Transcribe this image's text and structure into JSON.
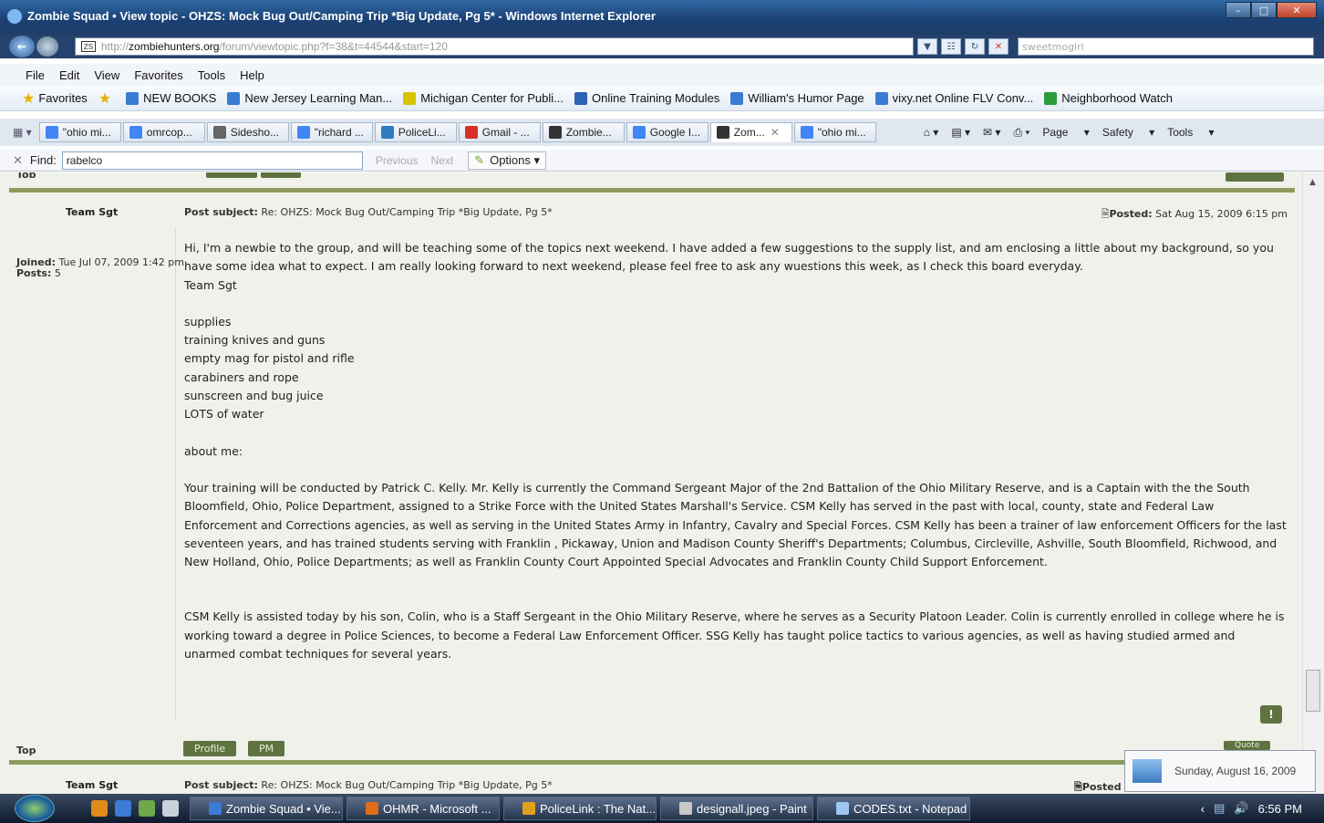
{
  "window": {
    "title": "Zombie Squad • View topic - OHZS: Mock Bug Out/Camping Trip *Big Update, Pg 5* - Windows Internet Explorer"
  },
  "address": {
    "url_prefix": "http://",
    "url_domain": "zombiehunters.org",
    "url_rest": "/forum/viewtopic.php?f=38&t=44544&start=120",
    "search_value": "sweetmogirl"
  },
  "menu": [
    "File",
    "Edit",
    "View",
    "Favorites",
    "Tools",
    "Help"
  ],
  "favorites": {
    "label": "Favorites",
    "items": [
      {
        "label": "NEW BOOKS",
        "color": "#3a7bd5"
      },
      {
        "label": "New Jersey Learning Man...",
        "color": "#3a7bd5"
      },
      {
        "label": "Michigan Center for Publi...",
        "color": "#d9c300"
      },
      {
        "label": "Online Training Modules",
        "color": "#2b63b5"
      },
      {
        "label": "William's Humor Page",
        "color": "#3a7bd5"
      },
      {
        "label": "vixy.net Online FLV Conv...",
        "color": "#3a7bd5"
      },
      {
        "label": "Neighborhood Watch",
        "color": "#2a9b3a"
      }
    ]
  },
  "tabs": [
    {
      "label": "\"ohio mi...",
      "color": "#4285f4"
    },
    {
      "label": "omrcop...",
      "color": "#4285f4"
    },
    {
      "label": "Sidesho...",
      "color": "#666666"
    },
    {
      "label": "\"richard ...",
      "color": "#4285f4"
    },
    {
      "label": "PoliceLi...",
      "color": "#2f7bbf"
    },
    {
      "label": "Gmail - ...",
      "color": "#d93025"
    },
    {
      "label": "Zombie...",
      "color": "#333333"
    },
    {
      "label": "Google I...",
      "color": "#4285f4"
    },
    {
      "label": "Zom...",
      "color": "#333333"
    },
    {
      "label": "\"ohio mi...",
      "color": "#4285f4"
    }
  ],
  "toolbar": {
    "page": "Page",
    "safety": "Safety",
    "tools": "Tools"
  },
  "find": {
    "label": "Find:",
    "value": "rabelco",
    "previous": "Previous",
    "next": "Next",
    "options": "Options"
  },
  "post": {
    "author": "Team Sgt",
    "subject_label": "Post subject:",
    "subject": "Re: OHZS: Mock Bug Out/Camping Trip *Big Update, Pg 5*",
    "posted_label": "Posted:",
    "posted": "Sat Aug 15, 2009 6:15 pm",
    "joined_label": "Joined:",
    "joined": "Tue Jul 07, 2009 1:42 pm",
    "posts_label": "Posts:",
    "posts": "5",
    "intro": "Hi, I'm a newbie to the group, and will be teaching some of the topics next weekend. I have added a few suggestions to the supply list, and am enclosing a little about my background, so you have some idea what to expect. I am really looking forward to next weekend, please feel free to ask any wuestions this week, as I check this board everyday.",
    "sign": "Team Sgt",
    "supplies": [
      "supplies",
      "training knives and guns",
      "empty mag for pistol and rifle",
      "carabiners and rope",
      "sunscreen and bug juice",
      "LOTS of water"
    ],
    "about": "about me:",
    "para1": "Your training will be conducted by Patrick C. Kelly. Mr. Kelly is currently the Command Sergeant Major of the 2nd Battalion of the Ohio Military Reserve, and is a Captain with the the South Bloomfield, Ohio, Police Department, assigned to a Strike Force with the United States Marshall's Service. CSM Kelly has served in the past with local, county, state and Federal Law Enforcement and Corrections agencies, as well as serving in the United States Army in Infantry, Cavalry and Special Forces. CSM Kelly has been a trainer of law enforcement Officers for the last seventeen years, and has trained students serving with Franklin , Pickaway, Union and Madison County Sheriff's Departments; Columbus, Circleville, Ashville, South Bloomfield, Richwood, and New Holland, Ohio, Police Departments; as well as Franklin County Court Appointed Special Advocates and Franklin County Child Support Enforcement.",
    "para2": "CSM Kelly is assisted today by his son, Colin, who is a Staff Sergeant in the Ohio Military Reserve, where he serves as a Security Platoon Leader. Colin is currently enrolled in college where he is working toward a degree in Police Sciences, to become a Federal Law Enforcement Officer. SSG Kelly has taught police tactics to various agencies, as well as having studied armed and unarmed combat techniques for several years."
  },
  "footer": {
    "top": "Top",
    "profile": "Profile",
    "pm": "PM",
    "quote": "Quote"
  },
  "next_post": {
    "author": "Team Sgt",
    "subject_label": "Post subject:",
    "subject": "Re: OHZS: Mock Bug Out/Camping Trip *Big Update, Pg 5*",
    "posted_label": "Posted"
  },
  "top_label": "Top",
  "taskbar": {
    "items": [
      {
        "label": "Zombie Squad • Vie...",
        "color": "#3a7bd5"
      },
      {
        "label": "OHMR - Microsoft ...",
        "color": "#e06c1a"
      },
      {
        "label": "PoliceLink : The Nat...",
        "color": "#e0a01a"
      },
      {
        "label": "designall.jpeg - Paint",
        "color": "#c8c8c8"
      },
      {
        "label": "CODES.txt - Notepad",
        "color": "#9fc6ef"
      }
    ],
    "time": "6:56 PM"
  },
  "date_popup": "Sunday, August 16, 2009"
}
